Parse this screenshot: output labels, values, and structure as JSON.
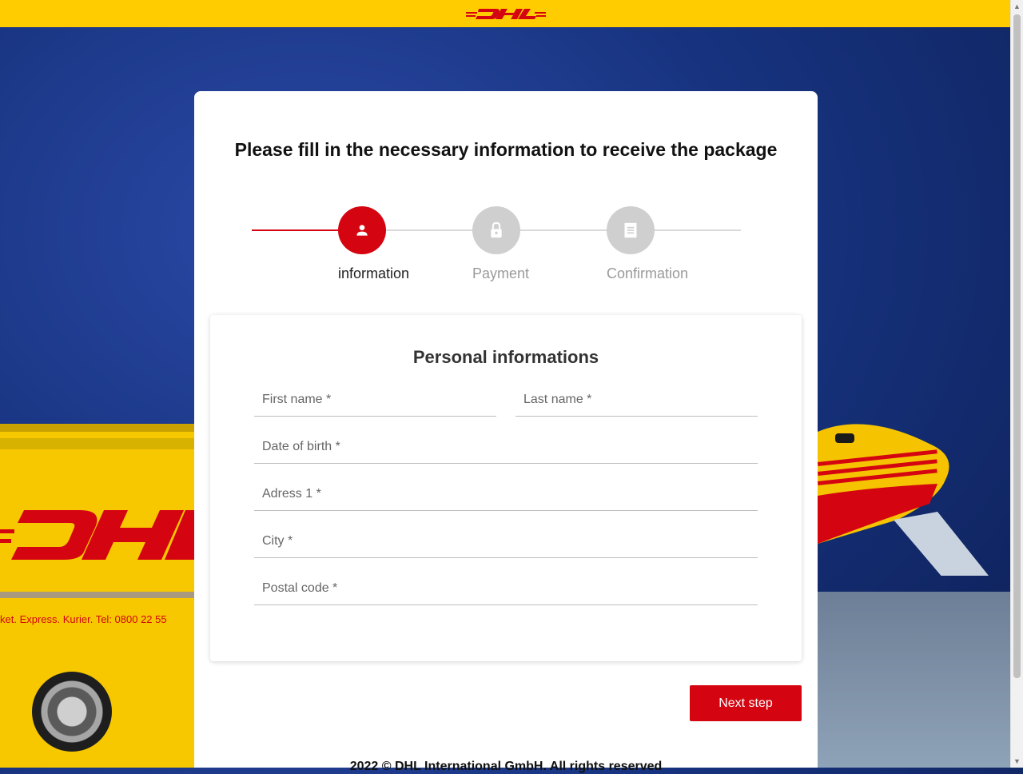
{
  "header": {
    "logo_text": "DHL",
    "brand_color": "#ffcc00",
    "accent_color": "#d40511"
  },
  "background": {
    "van_text": "ket. Express. Kurier.   Tel: 0800 22 55"
  },
  "main": {
    "title": "Please fill in the necessary information to receive the package",
    "steps": [
      {
        "label": "information",
        "icon": "person-icon",
        "state": "active"
      },
      {
        "label": "Payment",
        "icon": "lock-icon",
        "state": "inactive"
      },
      {
        "label": "Confirmation",
        "icon": "receipt-icon",
        "state": "inactive"
      }
    ],
    "form": {
      "title": "Personal informations",
      "first_name": {
        "placeholder": "First name *",
        "value": ""
      },
      "last_name": {
        "placeholder": "Last name *",
        "value": ""
      },
      "date_of_birth": {
        "placeholder": "Date of birth *",
        "value": ""
      },
      "address1": {
        "placeholder": "Adress 1 *",
        "value": ""
      },
      "city": {
        "placeholder": "City *",
        "value": ""
      },
      "postal_code": {
        "placeholder": "Postal code *",
        "value": ""
      }
    },
    "next_button": "Next step",
    "footer": "2022 © DHL International GmbH. All rights reserved"
  }
}
